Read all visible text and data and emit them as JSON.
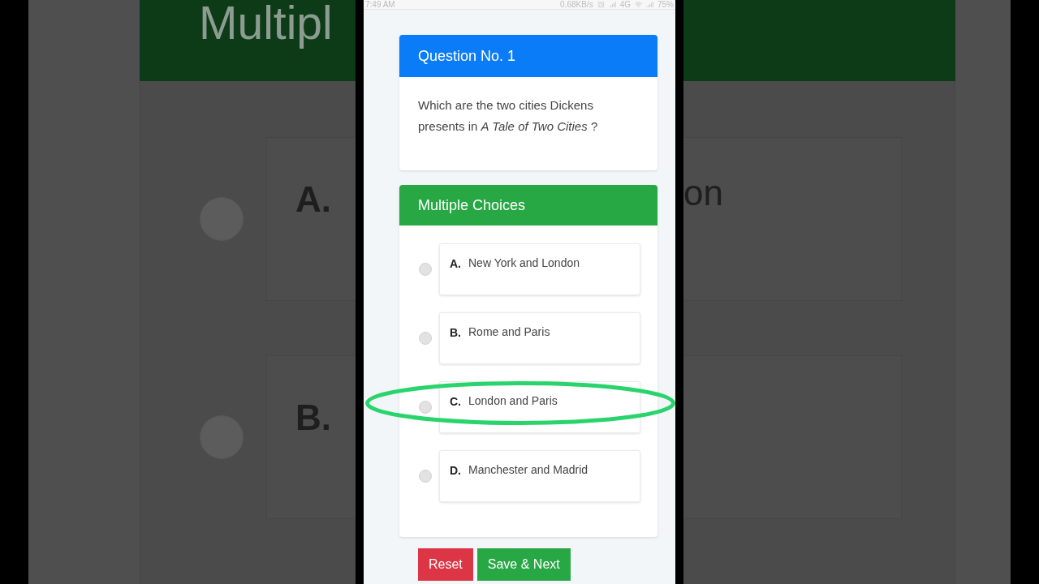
{
  "backdrop": {
    "left": {
      "header": "Multipl",
      "options": [
        "A.",
        "B."
      ]
    },
    "right": {
      "options": [
        "on"
      ]
    }
  },
  "status_bar": {
    "time": "7:49 AM",
    "speed": "0.68KB/s",
    "network": "4G",
    "battery": "75%"
  },
  "question": {
    "header": "Question No. 1",
    "text": "Which are the two cities Dickens presents in *A Tale of Two Cities* ?"
  },
  "choices": {
    "header": "Multiple Choices",
    "options": [
      {
        "letter": "A.",
        "text": "New York and London",
        "selected": false,
        "circled": false
      },
      {
        "letter": "B.",
        "text": "Rome and Paris",
        "selected": false,
        "circled": false
      },
      {
        "letter": "C.",
        "text": "London and Paris",
        "selected": false,
        "circled": true
      },
      {
        "letter": "D.",
        "text": "Manchester and Madrid",
        "selected": false,
        "circled": false
      }
    ]
  },
  "buttons": [
    {
      "label": "Reset",
      "kind": "danger"
    },
    {
      "label": "Save & Next",
      "kind": "primary"
    }
  ]
}
